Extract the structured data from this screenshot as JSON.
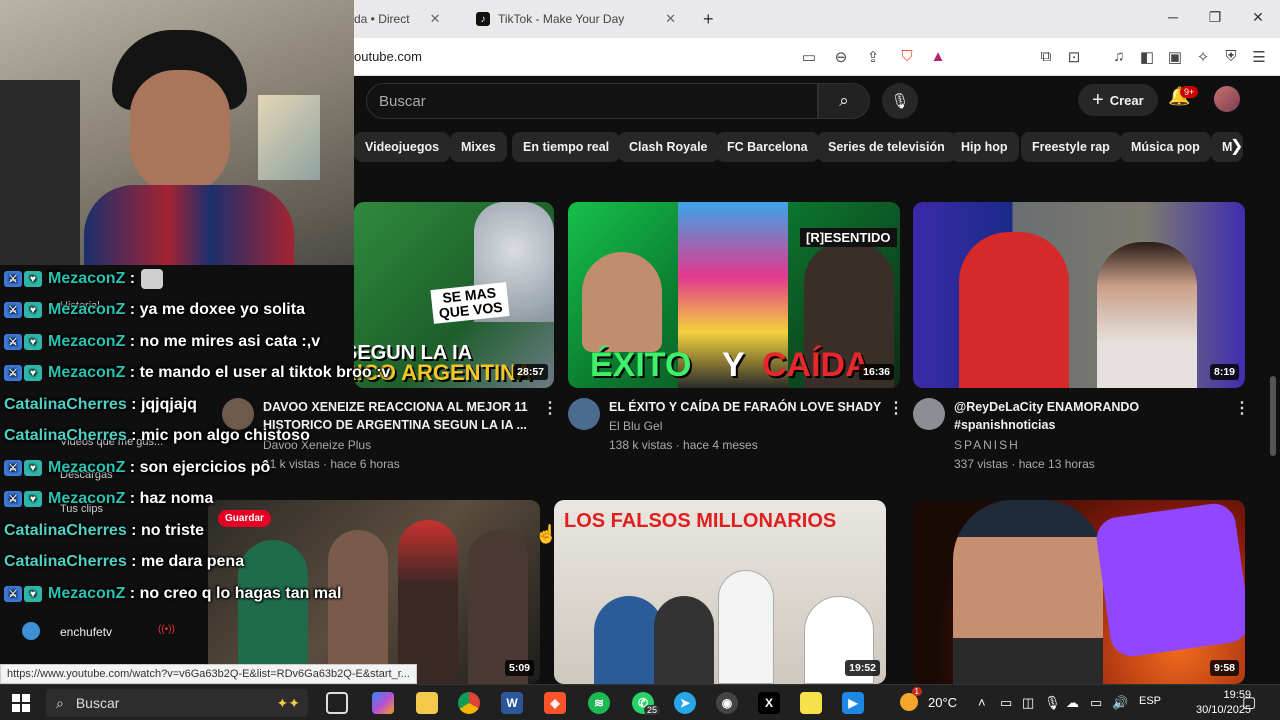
{
  "browser": {
    "tabs": [
      {
        "label": "da • Direct"
      },
      {
        "label": "TikTok - Make Your Day",
        "icon": "tiktok-icon"
      }
    ],
    "new_tab": "+",
    "url": "outube.com",
    "window_controls": {
      "minimize": "─",
      "maximize": "❐",
      "close": "✕"
    }
  },
  "youtube": {
    "search_placeholder": "Buscar",
    "create_label": "Crear",
    "notifications_badge": "9+",
    "chips": [
      "Videojuegos",
      "Mixes",
      "En tiempo real",
      "Clash Royale",
      "FC Barcelona",
      "Series de televisión",
      "Hip hop",
      "Freestyle rap",
      "Música pop",
      "M"
    ],
    "videos": [
      {
        "title_line1": "DAVOO XENEIZE REACCIONA AL MEJOR 11",
        "title_line2": "HISTORICO DE ARGENTINA SEGUN LA IA ...",
        "channel": "Davoo Xeneize Plus",
        "meta": "41 k vistas · hace 6 horas",
        "duration": "28:57",
        "overlay_top": "SE MAS QUE VOS",
        "overlay_bottom": "HISTORICO ARGENTINA",
        "overlay_mid": "SEGUN LA IA"
      },
      {
        "title_line1": "EL ÉXITO Y CAÍDA DE FARAÓN LOVE SHADY",
        "title_line2": "",
        "channel": "El Blu Gel",
        "meta": "138 k vistas · hace 4 meses",
        "duration": "16:36",
        "overlay_tag": "[R]ESENTIDO",
        "overlay_a": "ÉXITO",
        "overlay_b": "Y",
        "overlay_c": "CAÍDA"
      },
      {
        "title_line1": "@ReyDeLaCity ENAMORANDO",
        "title_line2": "#spanishnoticias",
        "channel": "SPANISH",
        "meta": "337 vistas · hace 13 horas",
        "duration": "8:19"
      },
      {
        "duration": "5:09",
        "pin_label": "Guardar"
      },
      {
        "duration": "19:52",
        "overlay_top": "LOS FALSOS MILLONARIOS"
      },
      {
        "duration": "9:58"
      }
    ]
  },
  "chat": [
    {
      "user": "MezaconZ",
      "msg": ":"
    },
    {
      "user": "MezaconZ",
      "msg": ": ya me doxee yo solita"
    },
    {
      "user": "MezaconZ",
      "msg": ": no me mires asi cata :,v"
    },
    {
      "user": "MezaconZ",
      "msg": ": te mando el user al tiktok broo :v"
    },
    {
      "user": "CatalinaCherres",
      "msg": ": jqjqjajq"
    },
    {
      "user": "CatalinaCherres",
      "msg": ": mic pon algo chistoso"
    },
    {
      "user": "MezaconZ",
      "msg": ": son ejercicios pô"
    },
    {
      "user": "MezaconZ",
      "msg": ": haz noma"
    },
    {
      "user": "CatalinaCherres",
      "msg": ": no triste"
    },
    {
      "user": "CatalinaCherres",
      "msg": ": me dara pena"
    },
    {
      "user": "MezaconZ",
      "msg": ": no creo q lo hagas tan mal"
    }
  ],
  "sidebar_ghost": {
    "historial": "Historial",
    "videos_like": "Videos que me gus...",
    "descargas": "Descargas",
    "tus_clips": "Tus clips",
    "enchufetv": "enchufetv"
  },
  "status_url": "https://www.youtube.com/watch?v=v6Ga63b2Q-E&list=RDv6Ga63b2Q-E&start_r...",
  "taskbar": {
    "search_label": "Buscar",
    "whatsapp_badge": "25",
    "weather_temp": "20°C",
    "weather_badge": "1",
    "language": "ESP",
    "time": "19:59",
    "date": "30/10/2025"
  }
}
